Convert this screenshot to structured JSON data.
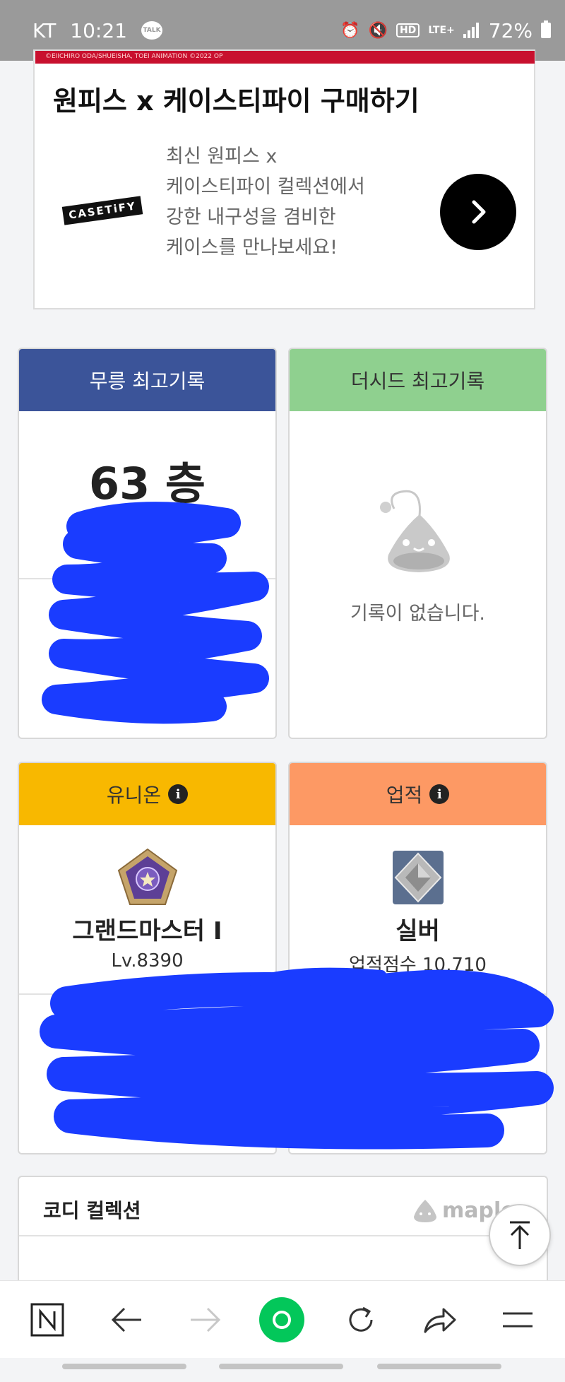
{
  "status_bar": {
    "carrier": "KT",
    "time": "10:21",
    "talk_badge": "TALK",
    "hd": "HD",
    "network": "LTE+",
    "battery": "72%"
  },
  "ad": {
    "image_caption": "©EIICHIRO ODA/SHUEISHA, TOEI ANIMATION  ©2022 OP",
    "title": "원피스 x 케이스티파이 구매하기",
    "brand": "CASETiFY",
    "description_lines": [
      "최신 원피스 x",
      "케이스티파이 컬렉션에서",
      "강한 내구성을 겸비한",
      "케이스를 만나보세요!"
    ]
  },
  "records": {
    "mureung": {
      "title": "무릉 최고기록",
      "value": "63 층"
    },
    "the_seed": {
      "title": "더시드 최고기록",
      "empty_text": "기록이 없습니다."
    }
  },
  "union": {
    "title": "유니온",
    "rank": "그랜드마스터 I",
    "level": "Lv.8390"
  },
  "achievement": {
    "title": "업적",
    "grade": "실버",
    "score": "업적점수 10,710"
  },
  "codi": {
    "title": "코디 컬렉션",
    "logo_text": "maple"
  },
  "colors": {
    "mureung_header": "#3b5499",
    "seed_header": "#8fd08f",
    "union_header": "#f8b800",
    "achievement_header": "#fd9964",
    "scribble": "#1a3cff",
    "browser_accent": "#03c75a"
  },
  "toolbar": [
    "naver-home",
    "back",
    "forward",
    "home-green",
    "reload",
    "share",
    "menu"
  ]
}
